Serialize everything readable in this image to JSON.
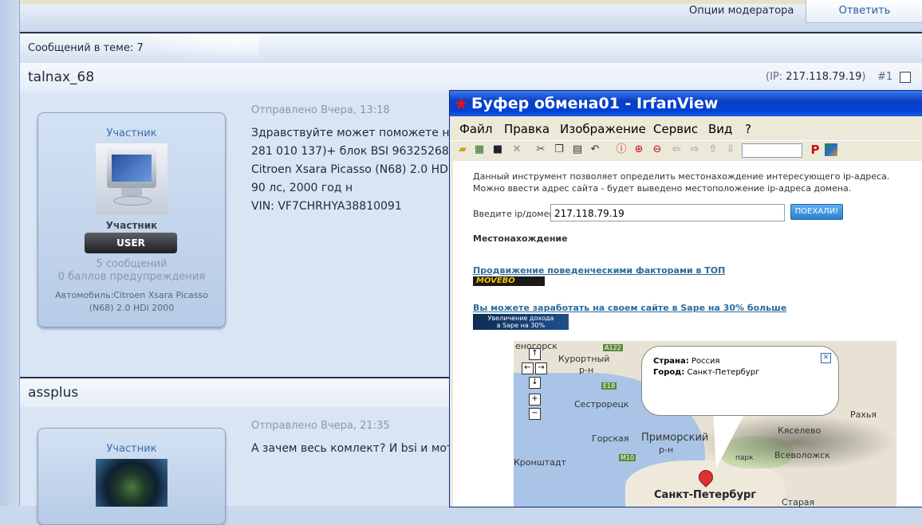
{
  "top": {
    "moderator_options": "Опции модератора",
    "reply_button": "Ответить"
  },
  "topic": {
    "message_count": "Сообщений в теме: 7"
  },
  "posts": [
    {
      "username": "talnax_68",
      "ip_prefix": "(IP: ",
      "ip": "217.118.79.19",
      "ip_suffix": ")",
      "number": "#1",
      "rank_top": "Участник",
      "rank_bottom": "Участник",
      "badge": "USER",
      "messages": "5 сообщений",
      "warnings": "0 баллов предупреждения",
      "car_line1": "Автомобиль:Citroen Xsara Picasso",
      "car_line2": "(N68) 2.0 HDi 2000",
      "date": "Отправлено Вчера, 13:18",
      "text_lines": [
        "Здравствуйте может поможете нж",
        "281 010 137)+ блок BSI 96325268",
        "Citroen Xsara Picasso (N68) 2.0 HD",
        "90 лс, 2000 год н",
        "VIN: VF7CHRHYA38810091"
      ]
    },
    {
      "username": "assplus",
      "rank_top": "Участник",
      "date": "Отправлено Вчера, 21:35",
      "text_lines": [
        "А зачем весь комлект? И bsi и мот"
      ]
    }
  ],
  "irfanview": {
    "title": "Буфер обмена01 - IrfanView",
    "menu": [
      "Файл",
      "Правка",
      "Изображение",
      "Сервис",
      "Вид",
      "?"
    ],
    "toolbar_icons": [
      "open-icon",
      "slideshow-icon",
      "save-icon",
      "delete-icon",
      "cut-icon",
      "copy-icon",
      "paste-icon",
      "undo-icon",
      "info-icon",
      "zoom-in-icon",
      "zoom-out-icon",
      "prev-icon",
      "next-icon",
      "first-icon",
      "last-icon",
      "paypal-icon",
      "palette-icon"
    ],
    "content": {
      "desc_line1": "Данный инструмент позволяет определить местонахождение интересующего ip-адреса.",
      "desc_line2": "Можно ввести адрес сайта - будет выведено местоположение ip-адреса домена.",
      "input_label": "Введите ip/домен:",
      "input_value": "217.118.79.19",
      "go_button": "ПОЕХАЛИ!",
      "location_heading": "Местонахождение",
      "link1": "Продвижение поведенческими факторами в ТОП",
      "banner1": "MOVEBO",
      "link2": "Вы можете заработать на своем сайте в Sape на 30% больше",
      "banner2_line1": "Увеличение дохода",
      "banner2_line2": "в Sape на 30%",
      "map": {
        "country_label": "Страна:",
        "country": "Россия",
        "city_label": "Город:",
        "city": "Санкт-Петербург",
        "labels": [
          "еногорск",
          "Курортный",
          "р-н",
          "Сестрорецк",
          "Горская",
          "Приморский",
          "р-н",
          "Кронштадт",
          "Санкт-Петербург",
          "Кяселево",
          "Всеволожск",
          "парк",
          "Рахья",
          "Старая"
        ],
        "roads": [
          "A122",
          "E18",
          "M10"
        ]
      }
    }
  }
}
